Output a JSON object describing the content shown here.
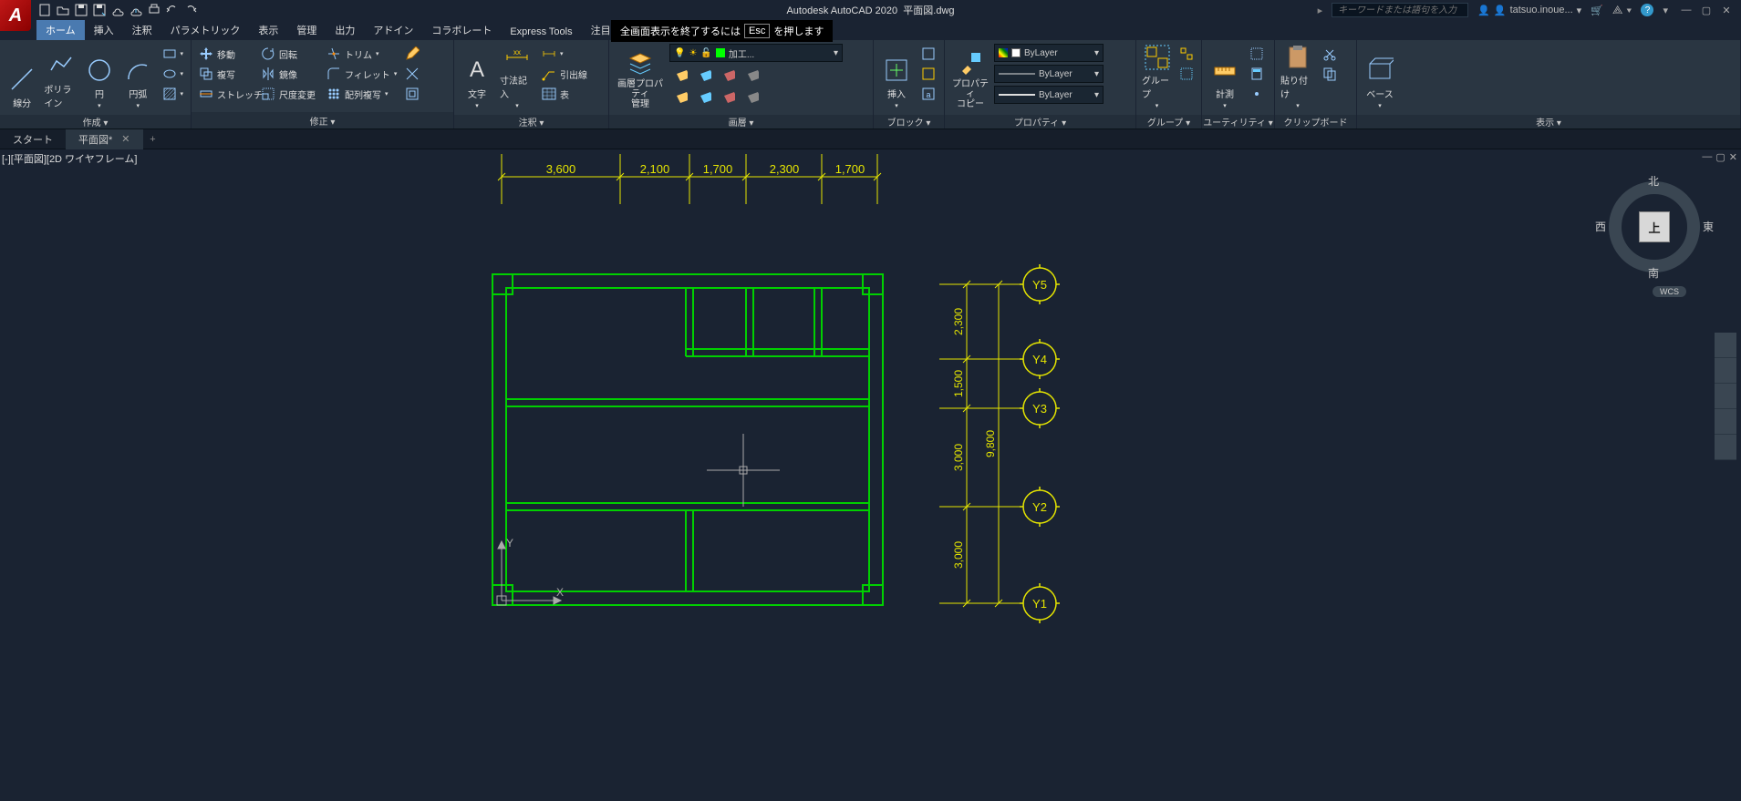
{
  "app": {
    "name": "Autodesk AutoCAD 2020",
    "file": "平面図.dwg",
    "search_ph": "キーワードまたは語句を入力",
    "user": "tatsuo.inoue..."
  },
  "fullscreen": {
    "pre": "全画面表示を終了するには",
    "key": "Esc",
    "post": "を押します"
  },
  "tabs": {
    "home": "ホーム",
    "insert": "挿入",
    "annotate": "注釈",
    "parametric": "パラメトリック",
    "view": "表示",
    "manage": "管理",
    "output": "出力",
    "addins": "アドイン",
    "collab": "コラボレート",
    "express": "Express Tools",
    "featured": "注目アプリ"
  },
  "ribbon": {
    "draw": {
      "title": "作成 ▾",
      "line": "線分",
      "polyline": "ポリライン",
      "circle": "円",
      "arc": "円弧"
    },
    "modify": {
      "title": "修正 ▾",
      "move": "移動",
      "rotate": "回転",
      "trim": "トリム",
      "copy": "複写",
      "mirror": "鏡像",
      "fillet": "フィレット",
      "stretch": "ストレッチ",
      "scale": "尺度変更",
      "array": "配列複写"
    },
    "annot": {
      "title": "注釈 ▾",
      "text": "文字",
      "dim": "寸法記入",
      "leader": "引出線",
      "table": "表"
    },
    "layers": {
      "title": "画層 ▾",
      "prop": "画層プロパティ\n管理",
      "current": "加工..."
    },
    "block": {
      "title": "ブロック ▾",
      "insert": "挿入"
    },
    "props": {
      "title": "プロパティ ▾",
      "bylayer": "ByLayer",
      "copy": "プロパティ\nコピー"
    },
    "groups": {
      "title": "グループ ▾",
      "group": "グループ"
    },
    "utils": {
      "title": "ユーティリティ ▾",
      "measure": "計測"
    },
    "clip": {
      "title": "クリップボード",
      "paste": "貼り付け"
    },
    "view": {
      "title": "表示 ▾",
      "base": "ベース"
    }
  },
  "doctabs": {
    "start": "スタート",
    "doc": "平面図*"
  },
  "viewport": {
    "label": "[-][平面図][2D ワイヤフレーム]"
  },
  "viewcube": {
    "n": "北",
    "s": "南",
    "e": "東",
    "w": "西",
    "top": "上",
    "wcs": "WCS"
  },
  "dims": {
    "top": [
      "3,600",
      "2,100",
      "1,700",
      "2,300",
      "1,700"
    ],
    "right": [
      "2,300",
      "1,500",
      "3,000",
      "3,000"
    ],
    "right_total": "9,800",
    "grids": [
      "Y5",
      "Y4",
      "Y3",
      "Y2",
      "Y1"
    ]
  }
}
